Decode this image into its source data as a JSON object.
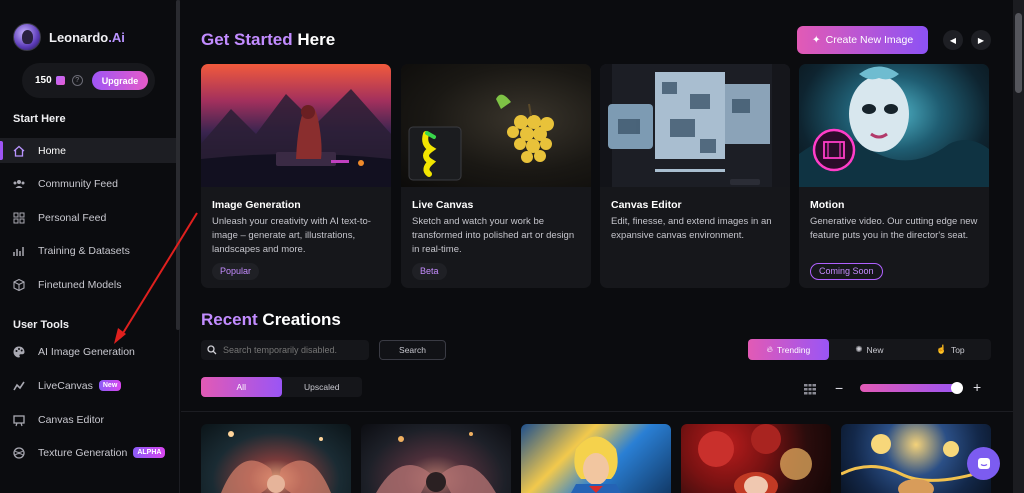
{
  "brand": {
    "name": "Leonardo",
    "name_suffix": ".Ai"
  },
  "credits": {
    "count": "150",
    "upgrade_label": "Upgrade",
    "help": "?"
  },
  "sidebar": {
    "start_heading": "Start Here",
    "start_items": [
      {
        "label": "Home",
        "icon": "home-icon",
        "active": true
      },
      {
        "label": "Community Feed",
        "icon": "community-icon"
      },
      {
        "label": "Personal Feed",
        "icon": "grid-icon"
      },
      {
        "label": "Training & Datasets",
        "icon": "training-icon"
      },
      {
        "label": "Finetuned Models",
        "icon": "cube-icon"
      }
    ],
    "tools_heading": "User Tools",
    "tool_items": [
      {
        "label": "AI Image Generation",
        "icon": "palette-icon"
      },
      {
        "label": "LiveCanvas",
        "icon": "livecanvas-icon",
        "badge": "New"
      },
      {
        "label": "Canvas Editor",
        "icon": "canvas-icon"
      },
      {
        "label": "Texture Generation",
        "icon": "texture-icon",
        "badge": "ALPHA"
      }
    ]
  },
  "header": {
    "title_accent": "Get Started",
    "title_rest": " Here",
    "create_label": "Create New Image",
    "prev": "◀",
    "next": "▶"
  },
  "cards": [
    {
      "title": "Image Generation",
      "desc": "Unleash your creativity with AI text-to-image – generate art, illustrations, landscapes and more.",
      "tag": "Popular"
    },
    {
      "title": "Live Canvas",
      "desc": "Sketch and watch your work be transformed into polished art or design in real-time.",
      "tag": "Beta"
    },
    {
      "title": "Canvas Editor",
      "desc": "Edit, finesse, and extend images in an expansive canvas environment.",
      "tag": ""
    },
    {
      "title": "Motion",
      "desc": "Generative video. Our cutting edge new feature puts you in the director's seat.",
      "tag": "Coming Soon"
    }
  ],
  "recent": {
    "title_accent": "Recent",
    "title_rest": " Creations",
    "search_placeholder": "Search temporarily disabled.",
    "search_button": "Search",
    "filters": [
      {
        "label": "Trending",
        "icon": "flame-icon",
        "active": true
      },
      {
        "label": "New",
        "icon": "sparkle-icon"
      },
      {
        "label": "Top",
        "icon": "hand-icon"
      }
    ],
    "toggles": [
      {
        "label": "All",
        "active": true
      },
      {
        "label": "Upscaled"
      }
    ],
    "zoom_minus": "−",
    "zoom_plus": "+",
    "zoom_level": 0.95
  },
  "colors": {
    "accent_purple": "#9f55f5",
    "accent_pink": "#e25ab5",
    "background": "#0b0c0f",
    "chat_button": "#7c5cf0"
  }
}
